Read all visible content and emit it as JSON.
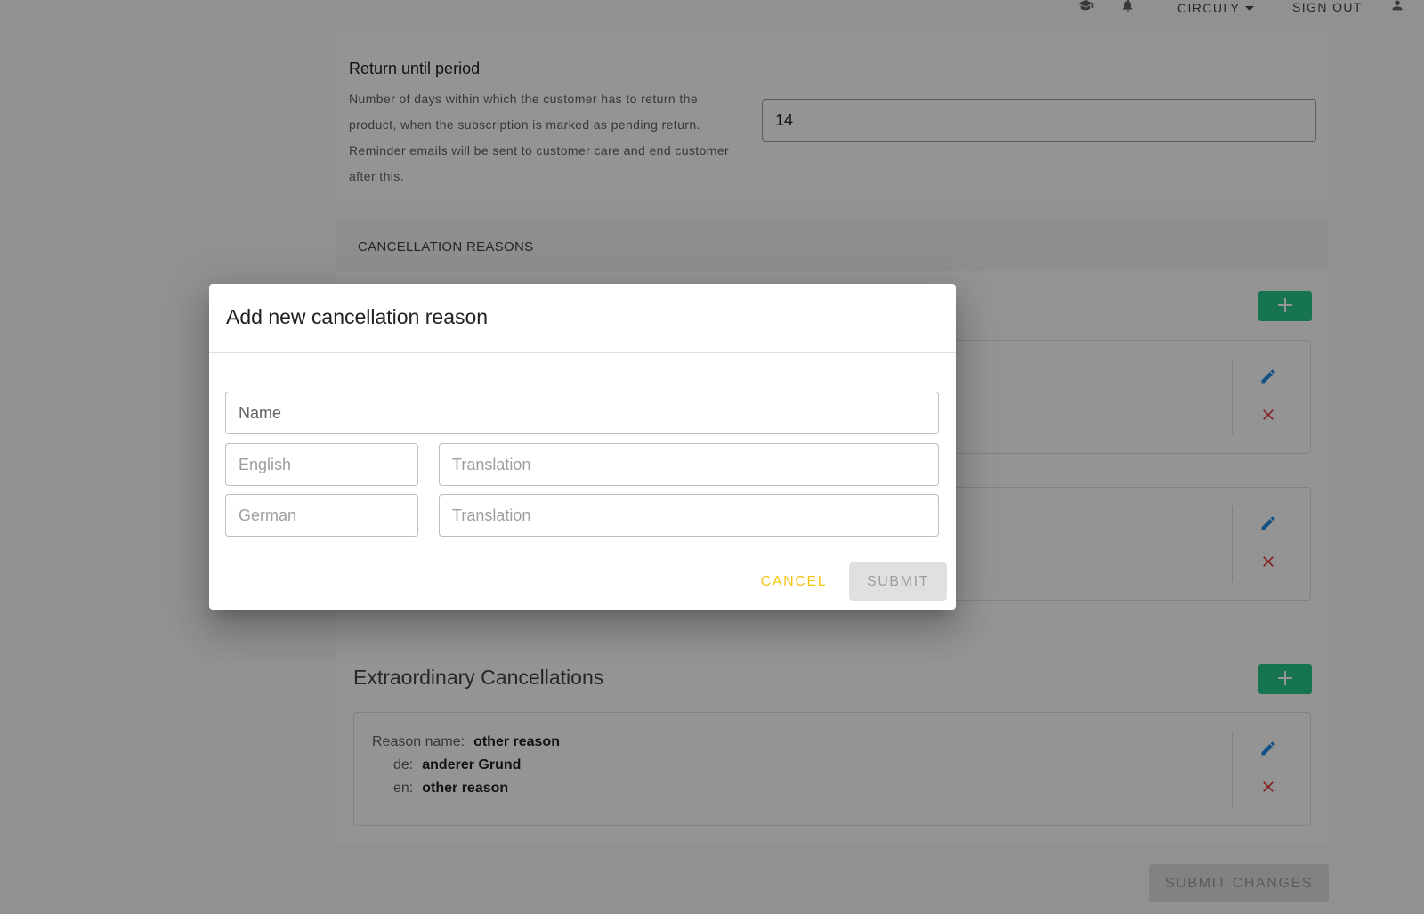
{
  "header": {
    "brand_label": "CIRCULY",
    "sign_out_label": "SIGN OUT",
    "icons": [
      "graduation-cap-icon",
      "bell-icon",
      "caret-down-icon",
      "user-icon"
    ]
  },
  "return_period": {
    "title": "Return until period",
    "description": "Number of days within which the customer has to return the product, when the subscription is marked as pending return. Reminder emails will be sent to customer care and end customer after this.",
    "value": "14"
  },
  "cancellation_reasons": {
    "header": "CANCELLATION REASONS"
  },
  "extraordinary": {
    "title": "Extraordinary Cancellations",
    "items": [
      {
        "reason_label": "Reason name:",
        "reason_value": "other reason",
        "de_label": "de:",
        "de_value": "anderer Grund",
        "en_label": "en:",
        "en_value": "other reason"
      }
    ]
  },
  "submit_changes_label": "SUBMIT CHANGES",
  "dialog": {
    "title": "Add new cancellation reason",
    "name_placeholder": "Name",
    "rows": [
      {
        "language_placeholder": "English",
        "translation_placeholder": "Translation"
      },
      {
        "language_placeholder": "German",
        "translation_placeholder": "Translation"
      }
    ],
    "cancel_label": "CANCEL",
    "submit_label": "SUBMIT"
  },
  "colors": {
    "accent_green": "#29c98a",
    "edit_blue": "#1e88e5",
    "delete_red": "#e53935",
    "cancel_yellow": "#f5c518"
  }
}
